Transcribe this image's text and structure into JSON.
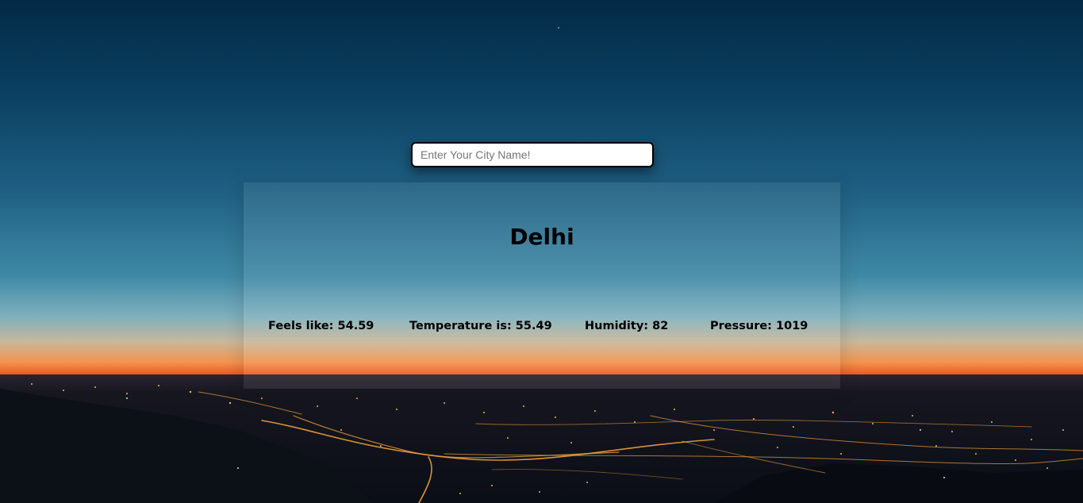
{
  "search": {
    "placeholder": "Enter Your City Name!",
    "value": ""
  },
  "weather": {
    "city": "Delhi",
    "feels_like": "Feels like: 54.59",
    "temperature": "Temperature is: 55.49",
    "humidity": "Humidity: 82",
    "pressure": "Pressure: 1019"
  },
  "colors": {
    "sky_top": "#032a45",
    "horizon": "#f3944e",
    "city_dark": "#0d121c",
    "text": "#000000"
  }
}
